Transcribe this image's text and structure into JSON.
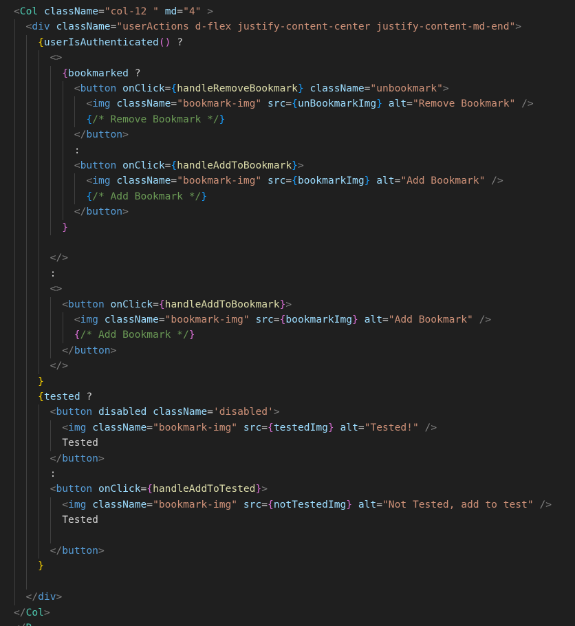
{
  "editor": {
    "language": "jsx",
    "lines": [
      {
        "indent": 1,
        "tokens": [
          [
            "punc",
            "<"
          ],
          [
            "tag",
            "Col"
          ],
          [
            "plain",
            " "
          ],
          [
            "attr",
            "className"
          ],
          [
            "plain",
            "="
          ],
          [
            "str",
            "\"col-12 \""
          ],
          [
            "plain",
            " "
          ],
          [
            "attr",
            "md"
          ],
          [
            "plain",
            "="
          ],
          [
            "str",
            "\"4\""
          ],
          [
            "plain",
            " "
          ],
          [
            "punc",
            ">"
          ]
        ]
      },
      {
        "indent": 2,
        "tokens": [
          [
            "punc",
            "<"
          ],
          [
            "html",
            "div"
          ],
          [
            "plain",
            " "
          ],
          [
            "attr",
            "className"
          ],
          [
            "plain",
            "="
          ],
          [
            "str",
            "\"userActions d-flex justify-content-center justify-content-md-end\""
          ],
          [
            "punc",
            ">"
          ]
        ]
      },
      {
        "indent": 3,
        "tokens": [
          [
            "brace1",
            "{"
          ],
          [
            "var",
            "userIsAuthenticated"
          ],
          [
            "brace2",
            "()"
          ],
          [
            "plain",
            " ?"
          ]
        ]
      },
      {
        "indent": 4,
        "tokens": [
          [
            "punc",
            "<>"
          ]
        ]
      },
      {
        "indent": 5,
        "tokens": [
          [
            "brace2",
            "{"
          ],
          [
            "var",
            "bookmarked"
          ],
          [
            "plain",
            " ?"
          ]
        ]
      },
      {
        "indent": 6,
        "tokens": [
          [
            "punc",
            "<"
          ],
          [
            "html",
            "button"
          ],
          [
            "plain",
            " "
          ],
          [
            "attr",
            "onClick"
          ],
          [
            "plain",
            "="
          ],
          [
            "brace3",
            "{"
          ],
          [
            "fn",
            "handleRemoveBookmark"
          ],
          [
            "brace3",
            "}"
          ],
          [
            "plain",
            " "
          ],
          [
            "attr",
            "className"
          ],
          [
            "plain",
            "="
          ],
          [
            "str",
            "\"unbookmark\""
          ],
          [
            "punc",
            ">"
          ]
        ]
      },
      {
        "indent": 7,
        "tokens": [
          [
            "punc",
            "<"
          ],
          [
            "html",
            "img"
          ],
          [
            "plain",
            " "
          ],
          [
            "attr",
            "className"
          ],
          [
            "plain",
            "="
          ],
          [
            "str",
            "\"bookmark-img\""
          ],
          [
            "plain",
            " "
          ],
          [
            "attr",
            "src"
          ],
          [
            "plain",
            "="
          ],
          [
            "brace3",
            "{"
          ],
          [
            "var",
            "unBookmarkImg"
          ],
          [
            "brace3",
            "}"
          ],
          [
            "plain",
            " "
          ],
          [
            "attr",
            "alt"
          ],
          [
            "plain",
            "="
          ],
          [
            "str",
            "\"Remove Bookmark\""
          ],
          [
            "plain",
            " "
          ],
          [
            "punc",
            "/>"
          ]
        ]
      },
      {
        "indent": 7,
        "tokens": [
          [
            "brace3",
            "{"
          ],
          [
            "cmt",
            "/* Remove Bookmark */"
          ],
          [
            "brace3",
            "}"
          ]
        ]
      },
      {
        "indent": 6,
        "tokens": [
          [
            "punc",
            "</"
          ],
          [
            "html",
            "button"
          ],
          [
            "punc",
            ">"
          ]
        ]
      },
      {
        "indent": 6,
        "tokens": [
          [
            "plain",
            ":"
          ]
        ]
      },
      {
        "indent": 6,
        "tokens": [
          [
            "punc",
            "<"
          ],
          [
            "html",
            "button"
          ],
          [
            "plain",
            " "
          ],
          [
            "attr",
            "onClick"
          ],
          [
            "plain",
            "="
          ],
          [
            "brace3",
            "{"
          ],
          [
            "fn",
            "handleAddToBookmark"
          ],
          [
            "brace3",
            "}"
          ],
          [
            "punc",
            ">"
          ]
        ]
      },
      {
        "indent": 7,
        "tokens": [
          [
            "punc",
            "<"
          ],
          [
            "html",
            "img"
          ],
          [
            "plain",
            " "
          ],
          [
            "attr",
            "className"
          ],
          [
            "plain",
            "="
          ],
          [
            "str",
            "\"bookmark-img\""
          ],
          [
            "plain",
            " "
          ],
          [
            "attr",
            "src"
          ],
          [
            "plain",
            "="
          ],
          [
            "brace3",
            "{"
          ],
          [
            "var",
            "bookmarkImg"
          ],
          [
            "brace3",
            "}"
          ],
          [
            "plain",
            " "
          ],
          [
            "attr",
            "alt"
          ],
          [
            "plain",
            "="
          ],
          [
            "str",
            "\"Add Bookmark\""
          ],
          [
            "plain",
            " "
          ],
          [
            "punc",
            "/>"
          ]
        ]
      },
      {
        "indent": 7,
        "tokens": [
          [
            "brace3",
            "{"
          ],
          [
            "cmt",
            "/* Add Bookmark */"
          ],
          [
            "brace3",
            "}"
          ]
        ]
      },
      {
        "indent": 6,
        "tokens": [
          [
            "punc",
            "</"
          ],
          [
            "html",
            "button"
          ],
          [
            "punc",
            ">"
          ]
        ]
      },
      {
        "indent": 5,
        "tokens": [
          [
            "brace2",
            "}"
          ]
        ]
      },
      {
        "indent": 4,
        "tokens": []
      },
      {
        "indent": 4,
        "tokens": [
          [
            "punc",
            "</>"
          ]
        ]
      },
      {
        "indent": 4,
        "tokens": [
          [
            "plain",
            ":"
          ]
        ]
      },
      {
        "indent": 4,
        "tokens": [
          [
            "punc",
            "<>"
          ]
        ]
      },
      {
        "indent": 5,
        "tokens": [
          [
            "punc",
            "<"
          ],
          [
            "html",
            "button"
          ],
          [
            "plain",
            " "
          ],
          [
            "attr",
            "onClick"
          ],
          [
            "plain",
            "="
          ],
          [
            "brace2",
            "{"
          ],
          [
            "fn",
            "handleAddToBookmark"
          ],
          [
            "brace2",
            "}"
          ],
          [
            "punc",
            ">"
          ]
        ]
      },
      {
        "indent": 6,
        "tokens": [
          [
            "punc",
            "<"
          ],
          [
            "html",
            "img"
          ],
          [
            "plain",
            " "
          ],
          [
            "attr",
            "className"
          ],
          [
            "plain",
            "="
          ],
          [
            "str",
            "\"bookmark-img\""
          ],
          [
            "plain",
            " "
          ],
          [
            "attr",
            "src"
          ],
          [
            "plain",
            "="
          ],
          [
            "brace2",
            "{"
          ],
          [
            "var",
            "bookmarkImg"
          ],
          [
            "brace2",
            "}"
          ],
          [
            "plain",
            " "
          ],
          [
            "attr",
            "alt"
          ],
          [
            "plain",
            "="
          ],
          [
            "str",
            "\"Add Bookmark\""
          ],
          [
            "plain",
            " "
          ],
          [
            "punc",
            "/>"
          ]
        ]
      },
      {
        "indent": 6,
        "tokens": [
          [
            "brace2",
            "{"
          ],
          [
            "cmt",
            "/* Add Bookmark */"
          ],
          [
            "brace2",
            "}"
          ]
        ]
      },
      {
        "indent": 5,
        "tokens": [
          [
            "punc",
            "</"
          ],
          [
            "html",
            "button"
          ],
          [
            "punc",
            ">"
          ]
        ]
      },
      {
        "indent": 4,
        "tokens": [
          [
            "punc",
            "</>"
          ]
        ]
      },
      {
        "indent": 3,
        "tokens": [
          [
            "brace1",
            "}"
          ]
        ]
      },
      {
        "indent": 3,
        "tokens": [
          [
            "brace1",
            "{"
          ],
          [
            "var",
            "tested"
          ],
          [
            "plain",
            " ?"
          ]
        ]
      },
      {
        "indent": 4,
        "tokens": [
          [
            "punc",
            "<"
          ],
          [
            "html",
            "button"
          ],
          [
            "plain",
            " "
          ],
          [
            "attr",
            "disabled"
          ],
          [
            "plain",
            " "
          ],
          [
            "attr",
            "className"
          ],
          [
            "plain",
            "="
          ],
          [
            "str",
            "'disabled'"
          ],
          [
            "punc",
            ">"
          ]
        ]
      },
      {
        "indent": 5,
        "tokens": [
          [
            "punc",
            "<"
          ],
          [
            "html",
            "img"
          ],
          [
            "plain",
            " "
          ],
          [
            "attr",
            "className"
          ],
          [
            "plain",
            "="
          ],
          [
            "str",
            "\"bookmark-img\""
          ],
          [
            "plain",
            " "
          ],
          [
            "attr",
            "src"
          ],
          [
            "plain",
            "="
          ],
          [
            "brace2",
            "{"
          ],
          [
            "var",
            "testedImg"
          ],
          [
            "brace2",
            "}"
          ],
          [
            "plain",
            " "
          ],
          [
            "attr",
            "alt"
          ],
          [
            "plain",
            "="
          ],
          [
            "str",
            "\"Tested!\""
          ],
          [
            "plain",
            " "
          ],
          [
            "punc",
            "/>"
          ]
        ]
      },
      {
        "indent": 5,
        "tokens": [
          [
            "plain",
            "Tested"
          ]
        ]
      },
      {
        "indent": 4,
        "tokens": [
          [
            "punc",
            "</"
          ],
          [
            "html",
            "button"
          ],
          [
            "punc",
            ">"
          ]
        ]
      },
      {
        "indent": 4,
        "tokens": [
          [
            "plain",
            ":"
          ]
        ]
      },
      {
        "indent": 4,
        "tokens": [
          [
            "punc",
            "<"
          ],
          [
            "html",
            "button"
          ],
          [
            "plain",
            " "
          ],
          [
            "attr",
            "onClick"
          ],
          [
            "plain",
            "="
          ],
          [
            "brace2",
            "{"
          ],
          [
            "fn",
            "handleAddToTested"
          ],
          [
            "brace2",
            "}"
          ],
          [
            "punc",
            ">"
          ]
        ]
      },
      {
        "indent": 5,
        "tokens": [
          [
            "punc",
            "<"
          ],
          [
            "html",
            "img"
          ],
          [
            "plain",
            " "
          ],
          [
            "attr",
            "className"
          ],
          [
            "plain",
            "="
          ],
          [
            "str",
            "\"bookmark-img\""
          ],
          [
            "plain",
            " "
          ],
          [
            "attr",
            "src"
          ],
          [
            "plain",
            "="
          ],
          [
            "brace2",
            "{"
          ],
          [
            "var",
            "notTestedImg"
          ],
          [
            "brace2",
            "}"
          ],
          [
            "plain",
            " "
          ],
          [
            "attr",
            "alt"
          ],
          [
            "plain",
            "="
          ],
          [
            "str",
            "\"Not Tested, add to test\""
          ],
          [
            "plain",
            " "
          ],
          [
            "punc",
            "/>"
          ]
        ]
      },
      {
        "indent": 5,
        "tokens": [
          [
            "plain",
            "Tested"
          ]
        ]
      },
      {
        "indent": 5,
        "tokens": []
      },
      {
        "indent": 4,
        "tokens": [
          [
            "punc",
            "</"
          ],
          [
            "html",
            "button"
          ],
          [
            "punc",
            ">"
          ]
        ]
      },
      {
        "indent": 3,
        "tokens": [
          [
            "brace1",
            "}"
          ]
        ]
      },
      {
        "indent": 3,
        "tokens": []
      },
      {
        "indent": 2,
        "tokens": [
          [
            "punc",
            "</"
          ],
          [
            "html",
            "div"
          ],
          [
            "punc",
            ">"
          ]
        ]
      },
      {
        "indent": 1,
        "tokens": [
          [
            "punc",
            "</"
          ],
          [
            "tag",
            "Col"
          ],
          [
            "punc",
            ">"
          ]
        ]
      },
      {
        "indent": 1,
        "tokens": [
          [
            "punc",
            "</"
          ],
          [
            "tag",
            "R"
          ]
        ]
      }
    ]
  }
}
